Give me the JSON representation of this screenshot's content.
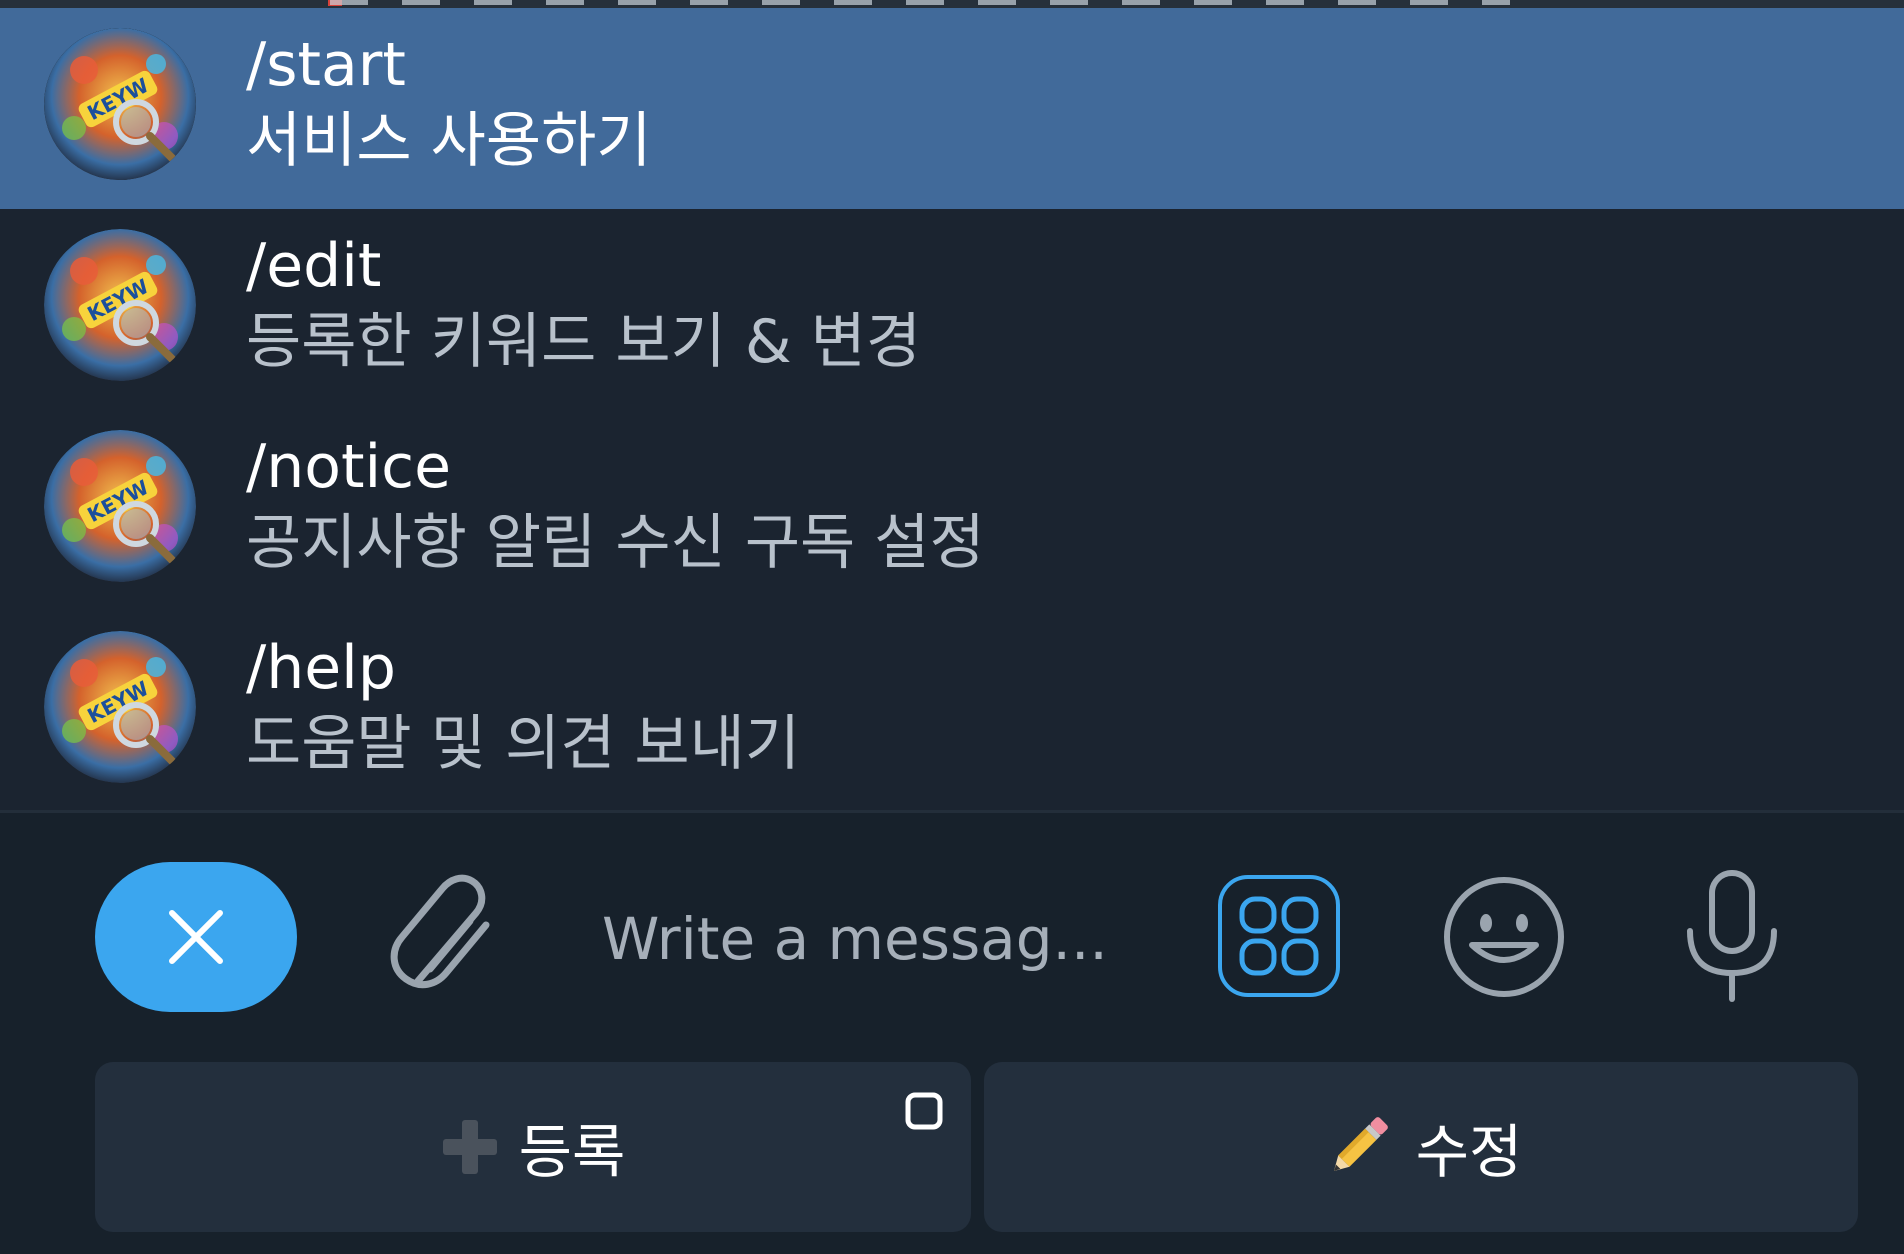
{
  "commands": [
    {
      "name": "/start",
      "description": "서비스 사용하기",
      "selected": true
    },
    {
      "name": "/edit",
      "description": "등록한 키워드 보기 & 변경",
      "selected": false
    },
    {
      "name": "/notice",
      "description": "공지사항 알림 수신 구독 설정",
      "selected": false
    },
    {
      "name": "/help",
      "description": "도움말 및 의견 보내기",
      "selected": false
    }
  ],
  "avatar_icon": "bot-avatar-keyword-magnifier",
  "composer": {
    "placeholder": "Write a messag...",
    "close_icon": "close-icon",
    "attach_icon": "paperclip-icon",
    "bot_menu_icon": "bot-menu-grid-icon",
    "emoji_icon": "smiley-icon",
    "mic_icon": "microphone-icon"
  },
  "keyboard": {
    "register_label": "등록",
    "register_icon": "plus-icon",
    "edit_label": "수정",
    "edit_icon": "pencil-icon",
    "corner_icon": "square-icon"
  },
  "colors": {
    "background": "#17212b",
    "list_background": "#1b2430",
    "selected_row": "#416a9a",
    "accent": "#3ba6ef",
    "keyboard_button": "#232f3d",
    "muted_text": "#b8c1cb",
    "placeholder_text": "#a6afb9"
  }
}
